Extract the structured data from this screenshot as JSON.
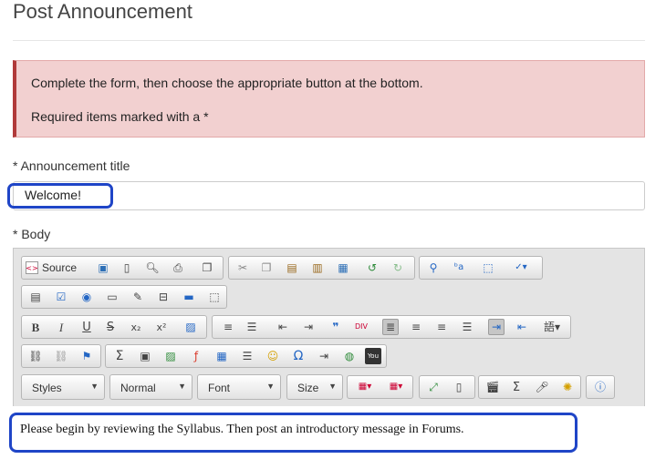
{
  "page": {
    "title": "Post Announcement"
  },
  "alert": {
    "line1": "Complete the form, then choose the appropriate button at the bottom.",
    "line2": "Required items marked with a *"
  },
  "fields": {
    "title_label": "* Announcement title",
    "title_value": "Welcome!",
    "body_label": "* Body"
  },
  "toolbar": {
    "source_label": "Source",
    "icon_colors": {
      "save": "#2d6fb6",
      "undo": "#2e8b3a",
      "flash": "#d93a2b",
      "accent": "#2366c4"
    },
    "row1": [
      "save-icon",
      "new-page-icon",
      "preview-icon",
      "print-icon",
      "templates-icon",
      "cut-icon",
      "copy-icon",
      "paste-icon",
      "paste-text-icon",
      "paste-word-icon",
      "undo-icon",
      "redo-icon",
      "find-icon",
      "replace-icon",
      "select-all-icon",
      "spellcheck-icon"
    ],
    "row2": [
      "form-icon",
      "checkbox-icon",
      "radio-icon",
      "text-field-icon",
      "textarea-icon",
      "select-icon",
      "button-icon",
      "hidden-field-icon"
    ],
    "row3": [
      "bold-icon",
      "italic-icon",
      "underline-icon",
      "strike-icon",
      "subscript-icon",
      "superscript-icon",
      "remove-format-icon",
      "numbered-list-icon",
      "bulleted-list-icon",
      "outdent-icon",
      "indent-icon",
      "blockquote-icon",
      "div-icon",
      "align-left-icon",
      "align-center-icon",
      "align-right-icon",
      "justify-icon",
      "ltr-icon",
      "rtl-icon",
      "language-icon"
    ],
    "row4": [
      "link-icon",
      "unlink-icon",
      "anchor-icon",
      "math-icon",
      "media-icon",
      "image-icon",
      "flash-icon",
      "table-icon",
      "horizontal-rule-icon",
      "smiley-icon",
      "special-char-icon",
      "page-break-icon",
      "iframe-icon",
      "youtube-icon"
    ],
    "styles_combo": "Styles",
    "format_combo": "Normal",
    "font_combo": "Font",
    "size_combo": "Size",
    "row5": [
      "text-color-icon",
      "table-color-icon",
      "maximize-icon",
      "show-blocks-icon",
      "movie-icon",
      "equation-icon",
      "audio-icon",
      "widget-icon",
      "about-icon"
    ]
  },
  "editor": {
    "content": "Please begin by reviewing the Syllabus. Then post an introductory message in Forums."
  }
}
